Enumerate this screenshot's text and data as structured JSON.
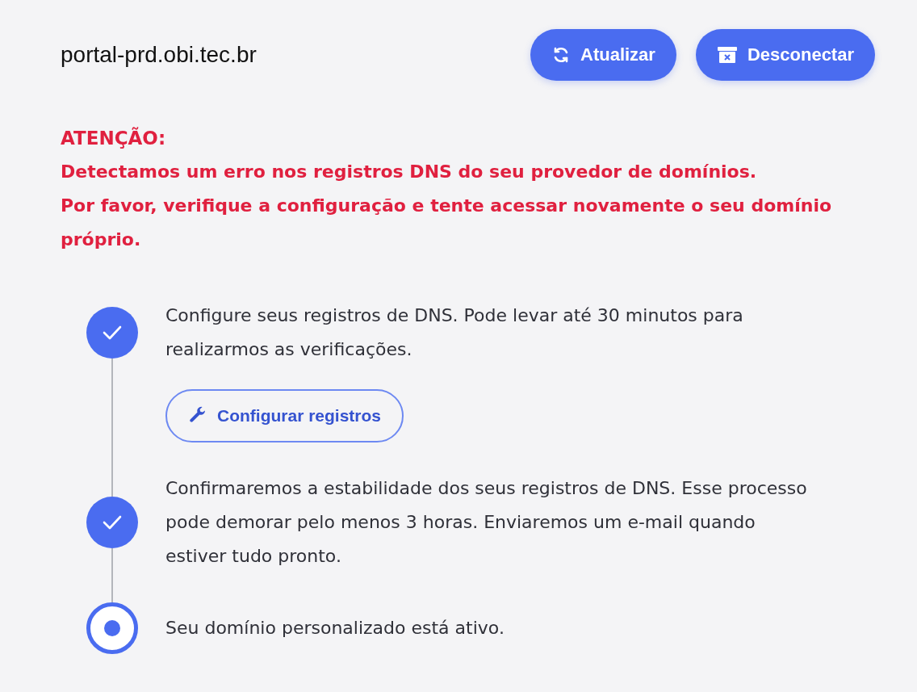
{
  "header": {
    "domain": "portal-prd.obi.tec.br",
    "buttons": [
      {
        "kind": "refresh",
        "label": "Atualizar"
      },
      {
        "kind": "disconnect",
        "label": "Desconectar"
      }
    ]
  },
  "alert": {
    "title": "ATENÇÃO:",
    "messages": [
      "Detectamos um erro nos registros DNS do seu provedor de domínios.",
      "Por favor, verifique a configuração e tente acessar novamente o seu domínio próprio."
    ]
  },
  "steps": [
    {
      "kind": "done",
      "text": "Configure seus registros de DNS. Pode levar até 30 minutos para realizarmos as verificações.",
      "action": "Configurar registros"
    },
    {
      "kind": "done",
      "text": "Confirmaremos a estabilidade dos seus registros de DNS. Esse processo pode demorar pelo menos 3 horas. Enviaremos um e-mail quando estiver tudo pronto."
    },
    {
      "kind": "current",
      "text": "Seu domínio personalizado está ativo."
    }
  ]
}
